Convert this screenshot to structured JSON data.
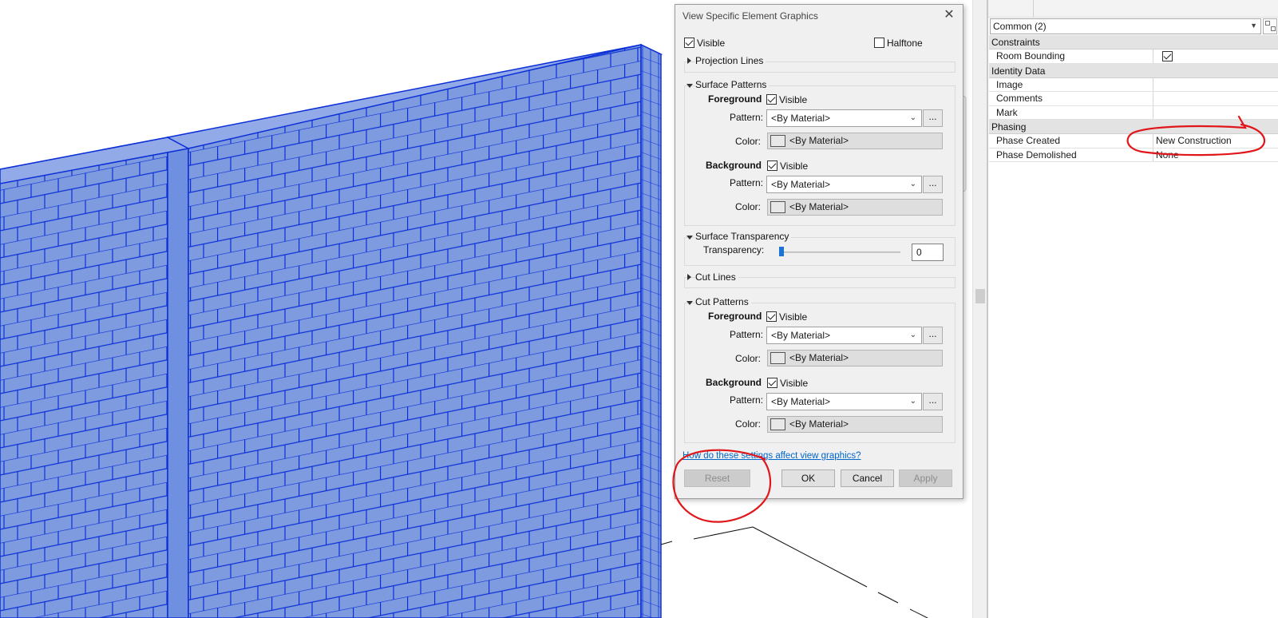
{
  "dialog": {
    "title": "View Specific Element Graphics",
    "visible_label": "Visible",
    "halftone_label": "Halftone",
    "projection_lines": "Projection Lines",
    "surface_patterns": "Surface Patterns",
    "foreground_label": "Foreground",
    "background_label": "Background",
    "pattern_label": "Pattern:",
    "color_label": "Color:",
    "by_material": "<By Material>",
    "browse": "...",
    "surface_transparency": "Surface Transparency",
    "transparency_label": "Transparency:",
    "transparency_value": "0",
    "transparency_percent": 0,
    "cut_lines": "Cut Lines",
    "cut_patterns": "Cut Patterns",
    "help_link": "How do these settings affect view graphics?",
    "buttons": {
      "reset": "Reset",
      "ok": "OK",
      "cancel": "Cancel",
      "apply": "Apply"
    }
  },
  "properties": {
    "filter": "Common (2)",
    "groups": [
      {
        "name": "Constraints",
        "rows": [
          {
            "name": "Room Bounding",
            "value": "",
            "checkbox": true
          }
        ]
      },
      {
        "name": "Identity Data",
        "rows": [
          {
            "name": "Image",
            "value": ""
          },
          {
            "name": "Comments",
            "value": ""
          },
          {
            "name": "Mark",
            "value": ""
          }
        ]
      },
      {
        "name": "Phasing",
        "rows": [
          {
            "name": "Phase Created",
            "value": "New Construction"
          },
          {
            "name": "Phase Demolished",
            "value": "None"
          }
        ]
      }
    ]
  },
  "colors": {
    "wall_fill": "#7e9be0",
    "wall_line": "#0b2fd6",
    "annotation": "#e0161b",
    "link": "#0066cc",
    "slider_thumb": "#1a74d8"
  }
}
